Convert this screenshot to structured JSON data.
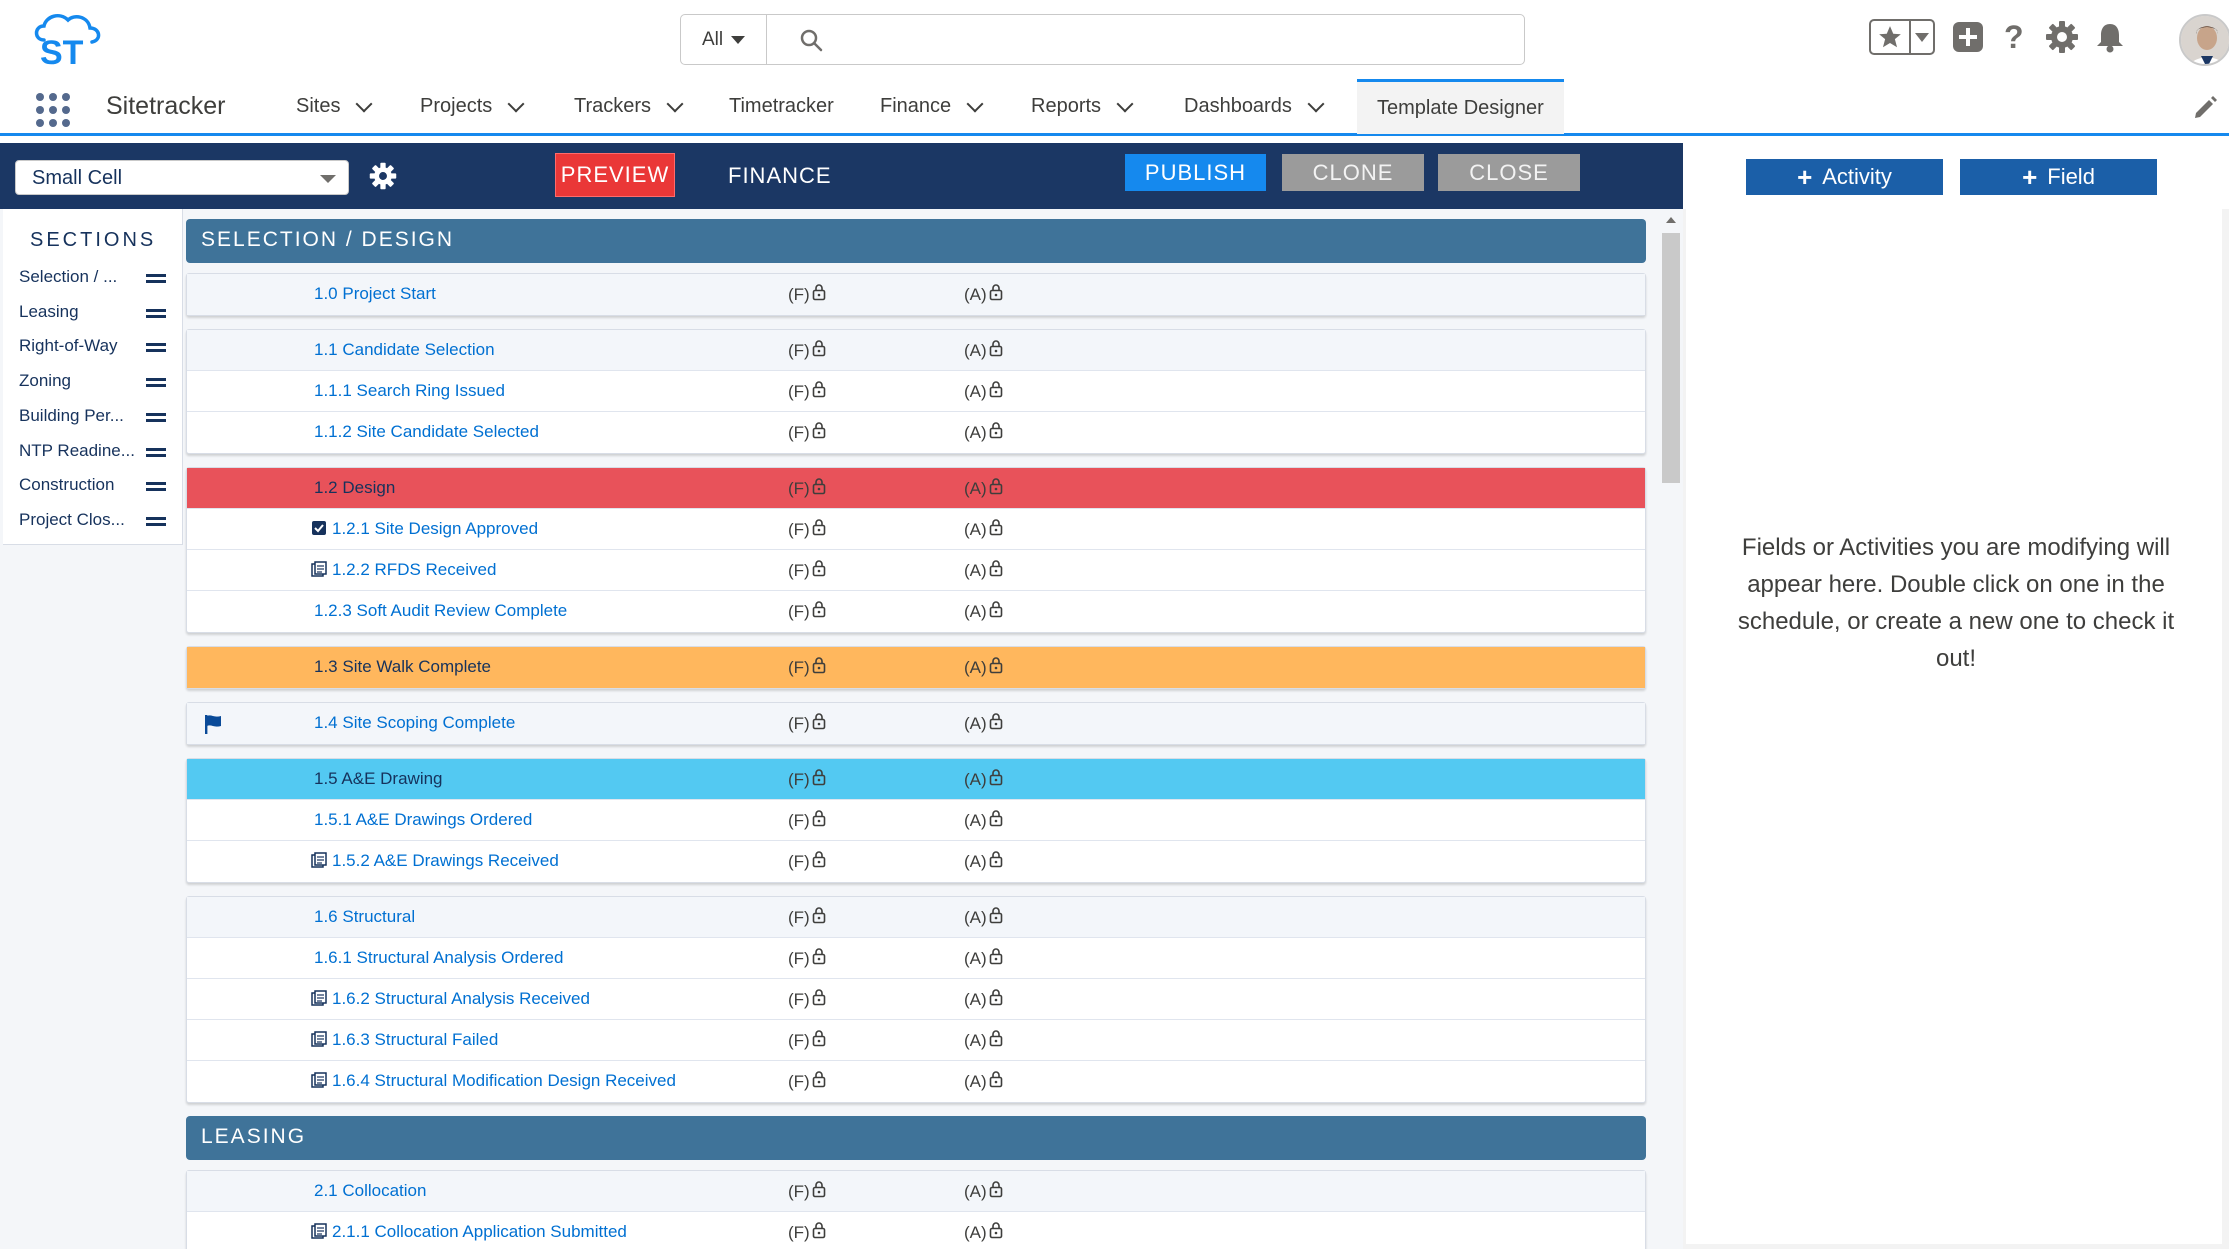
{
  "header": {
    "search_scope": "All",
    "search_placeholder": "",
    "icons": [
      "favorites-star-icon",
      "add-icon",
      "help-icon",
      "setup-gear-icon",
      "notifications-bell-icon",
      "user-avatar"
    ]
  },
  "nav": {
    "app_name": "Sitetracker",
    "items": [
      {
        "label": "Sites",
        "has_menu": true
      },
      {
        "label": "Projects",
        "has_menu": true
      },
      {
        "label": "Trackers",
        "has_menu": true
      },
      {
        "label": "Timetracker",
        "has_menu": false
      },
      {
        "label": "Finance",
        "has_menu": true
      },
      {
        "label": "Reports",
        "has_menu": true
      },
      {
        "label": "Dashboards",
        "has_menu": true
      },
      {
        "label": "Template Designer",
        "has_menu": false,
        "active": true
      }
    ]
  },
  "designer": {
    "template_select": "Small Cell",
    "preview_label": "PREVIEW",
    "view_label": "FINANCE",
    "publish_label": "PUBLISH",
    "clone_label": "CLONE",
    "close_label": "CLOSE"
  },
  "right_panel": {
    "add_activity_label": "Activity",
    "add_field_label": "Field",
    "message": "Fields or Activities you are modifying will appear here. Double click on one in the schedule, or create a new one to check it out!"
  },
  "sections_nav": {
    "title": "SECTIONS",
    "items": [
      "Selection / ...",
      "Leasing",
      "Right-of-Way",
      "Zoning",
      "Building Per...",
      "NTP Readine...",
      "Construction",
      "Project Clos..."
    ]
  },
  "schedule": {
    "col_f": "(F)",
    "col_a": "(A)",
    "sections": [
      {
        "title": "SELECTION / DESIGN",
        "groups": [
          {
            "rows": [
              {
                "name": "1.0 Project Start",
                "kind": "parent"
              }
            ]
          },
          {
            "rows": [
              {
                "name": "1.1 Candidate Selection",
                "kind": "parent"
              },
              {
                "name": "1.1.1 Search Ring Issued"
              },
              {
                "name": "1.1.2 Site Candidate Selected"
              }
            ]
          },
          {
            "rows": [
              {
                "name": "1.2 Design",
                "kind": "parent",
                "color": "red"
              },
              {
                "name": "1.2.1 Site Design Approved",
                "icon": "checkbox-icon"
              },
              {
                "name": "1.2.2 RFDS Received",
                "icon": "document-icon"
              },
              {
                "name": "1.2.3 Soft Audit Review Complete"
              }
            ]
          },
          {
            "rows": [
              {
                "name": "1.3 Site Walk Complete",
                "kind": "parent",
                "color": "orange"
              }
            ]
          },
          {
            "rows": [
              {
                "name": "1.4 Site Scoping Complete",
                "kind": "parent",
                "flag": true
              }
            ]
          },
          {
            "rows": [
              {
                "name": "1.5 A&E Drawing",
                "kind": "parent",
                "color": "cyan"
              },
              {
                "name": "1.5.1 A&E Drawings Ordered"
              },
              {
                "name": "1.5.2 A&E Drawings Received",
                "icon": "document-icon"
              }
            ]
          },
          {
            "rows": [
              {
                "name": "1.6 Structural",
                "kind": "parent"
              },
              {
                "name": "1.6.1 Structural Analysis Ordered"
              },
              {
                "name": "1.6.2 Structural Analysis Received",
                "icon": "document-icon"
              },
              {
                "name": "1.6.3 Structural Failed",
                "icon": "document-icon"
              },
              {
                "name": "1.6.4 Structural Modification Design Received",
                "icon": "document-icon"
              }
            ]
          }
        ]
      },
      {
        "title": "LEASING",
        "groups": [
          {
            "rows": [
              {
                "name": "2.1 Collocation",
                "kind": "parent"
              },
              {
                "name": "2.1.1 Collocation Application Submitted",
                "icon": "document-icon"
              }
            ]
          }
        ]
      }
    ]
  },
  "colors": {
    "navy_bar": "#1b3764",
    "section_header": "#3f7399",
    "preview_red": "#ea3737",
    "publish_blue": "#1589ee",
    "row_red": "#e8525a",
    "row_orange": "#ffb75d",
    "row_cyan": "#53c9f2",
    "link_blue": "#0070d2"
  }
}
